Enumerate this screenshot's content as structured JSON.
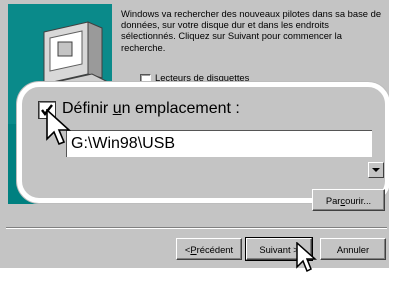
{
  "description": "Windows va rechercher des nouveaux pilotes dans sa base de données, sur votre disque dur et dans les endroits sélectionnés. Cliquez sur Suivant pour commencer la recherche.",
  "options": {
    "floppy_label": "Lecteurs de disquettes",
    "location_label_pre": "Définir ",
    "location_label_accel": "u",
    "location_label_post": "n emplacement :",
    "location_checked": true,
    "location_value": "G:\\Win98\\USB"
  },
  "buttons": {
    "browse_pre": "Par",
    "browse_accel": "c",
    "browse_post": "ourir...",
    "back_prefix": "< ",
    "back_accel": "P",
    "back_post": "récédent",
    "next_label": "Suivant >",
    "cancel_label": "Annuler"
  },
  "icons": {
    "wizard_art": "computer-with-cd-icon",
    "cursor": "arrow-cursor-icon"
  }
}
